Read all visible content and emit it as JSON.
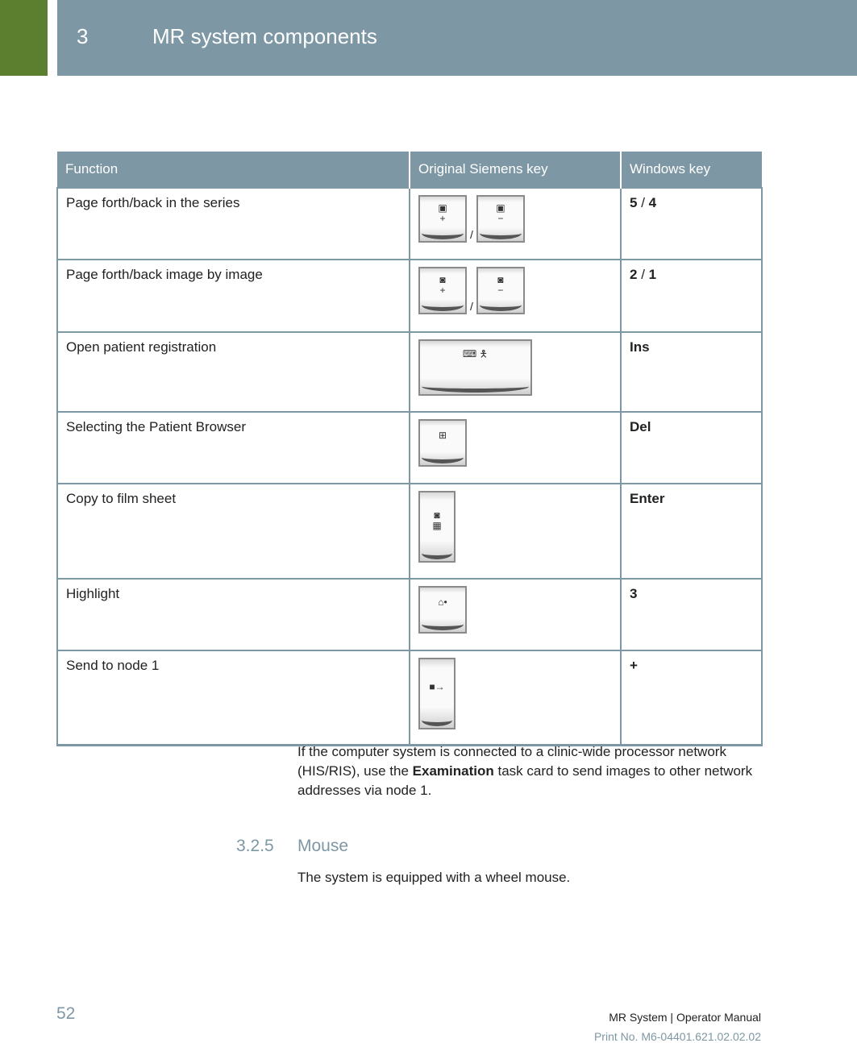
{
  "header": {
    "chapter_number": "3",
    "chapter_title": "MR system components",
    "accent_color": "#5b7f2e",
    "header_color": "#7e97a4"
  },
  "table": {
    "columns": [
      "Function",
      "Original Siemens key",
      "Windows key"
    ],
    "rows": [
      {
        "function": "Page forth/back in the series",
        "siemens_keys": [
          "series-forward-key-icon",
          "series-back-key-icon"
        ],
        "key_separator": "/",
        "windows_key": [
          "5",
          "4"
        ]
      },
      {
        "function": "Page forth/back image by image",
        "siemens_keys": [
          "image-forward-key-icon",
          "image-back-key-icon"
        ],
        "key_separator": "/",
        "windows_key": [
          "2",
          "1"
        ]
      },
      {
        "function": "Open patient registration",
        "siemens_keys": [
          "patient-registration-key-icon"
        ],
        "windows_key": [
          "Ins"
        ]
      },
      {
        "function": "Selecting the Patient Browser",
        "siemens_keys": [
          "patient-browser-key-icon"
        ],
        "windows_key": [
          "Del"
        ]
      },
      {
        "function": "Copy to film sheet",
        "siemens_keys": [
          "copy-to-film-key-icon"
        ],
        "windows_key": [
          "Enter"
        ]
      },
      {
        "function": "Highlight",
        "siemens_keys": [
          "highlight-key-icon"
        ],
        "windows_key": [
          "3"
        ]
      },
      {
        "function": "Send to node 1",
        "siemens_keys": [
          "send-to-node-key-icon"
        ],
        "windows_key": [
          "+"
        ]
      }
    ],
    "win_separator": " / "
  },
  "body": {
    "para1_before": "If the computer system is connected to a clinic-wide processor network (HIS/RIS), use the ",
    "para1_bold": "Examination",
    "para1_after": " task card to send images to other network addresses via node 1.",
    "section_number": "3.2.5",
    "section_title": "Mouse",
    "para2": "The system is equipped with a wheel mouse."
  },
  "footer": {
    "page_number": "52",
    "manual_title": "MR System | Operator Manual",
    "print_number": "Print No. M6-04401.621.02.02.02"
  }
}
